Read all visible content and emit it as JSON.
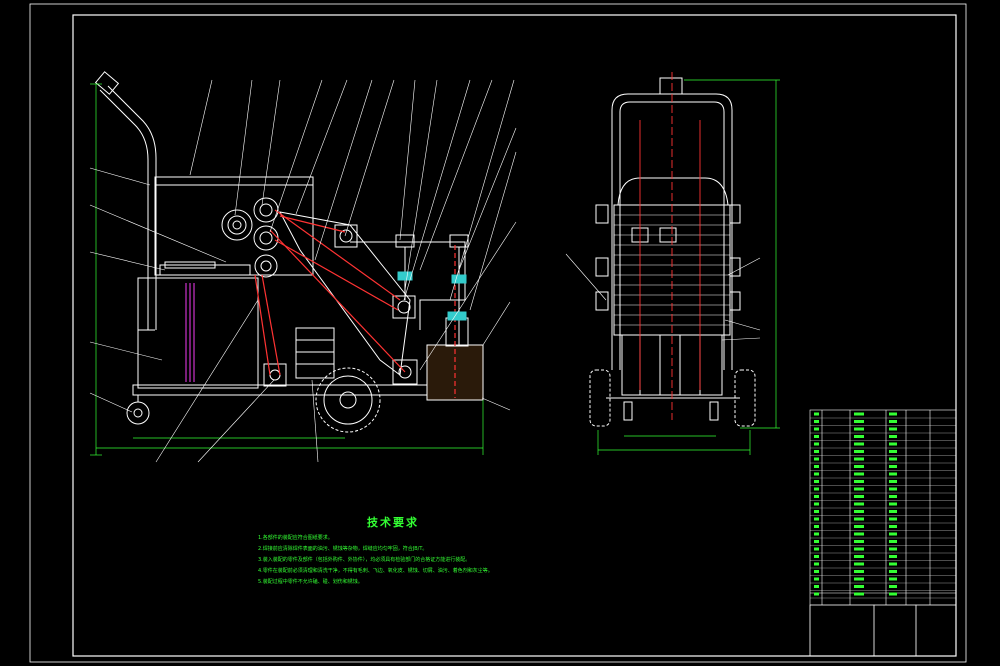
{
  "notes": {
    "title": "技术要求",
    "items": [
      "1.各部件的装配应符合图纸要求。",
      "2.焊接前应清除焊件表面的油污、锈蚀等杂物，焊缝应均匀牢固，符合JB/T。",
      "3.装入装配的零件及部件（包括外购件、外协件），均必须具有检验部门的合格证方能进行装配。",
      "4.零件在装配前必须清理和清洗干净，不得有毛刺、飞边、氧化皮、锈蚀、切屑、油污、着色剂和灰尘等。",
      "5.装配过程中零件不允许磕、碰、划伤和锈蚀。"
    ]
  },
  "colors": {
    "frame": "#ffffff",
    "outline": "#ffffff",
    "centerline": "#ff3333",
    "dimension": "#33ff33",
    "leader": "#ffffff",
    "accent_magenta": "#cc33cc",
    "accent_cyan": "#33cccc",
    "titleblock_text": "#33ff33"
  }
}
